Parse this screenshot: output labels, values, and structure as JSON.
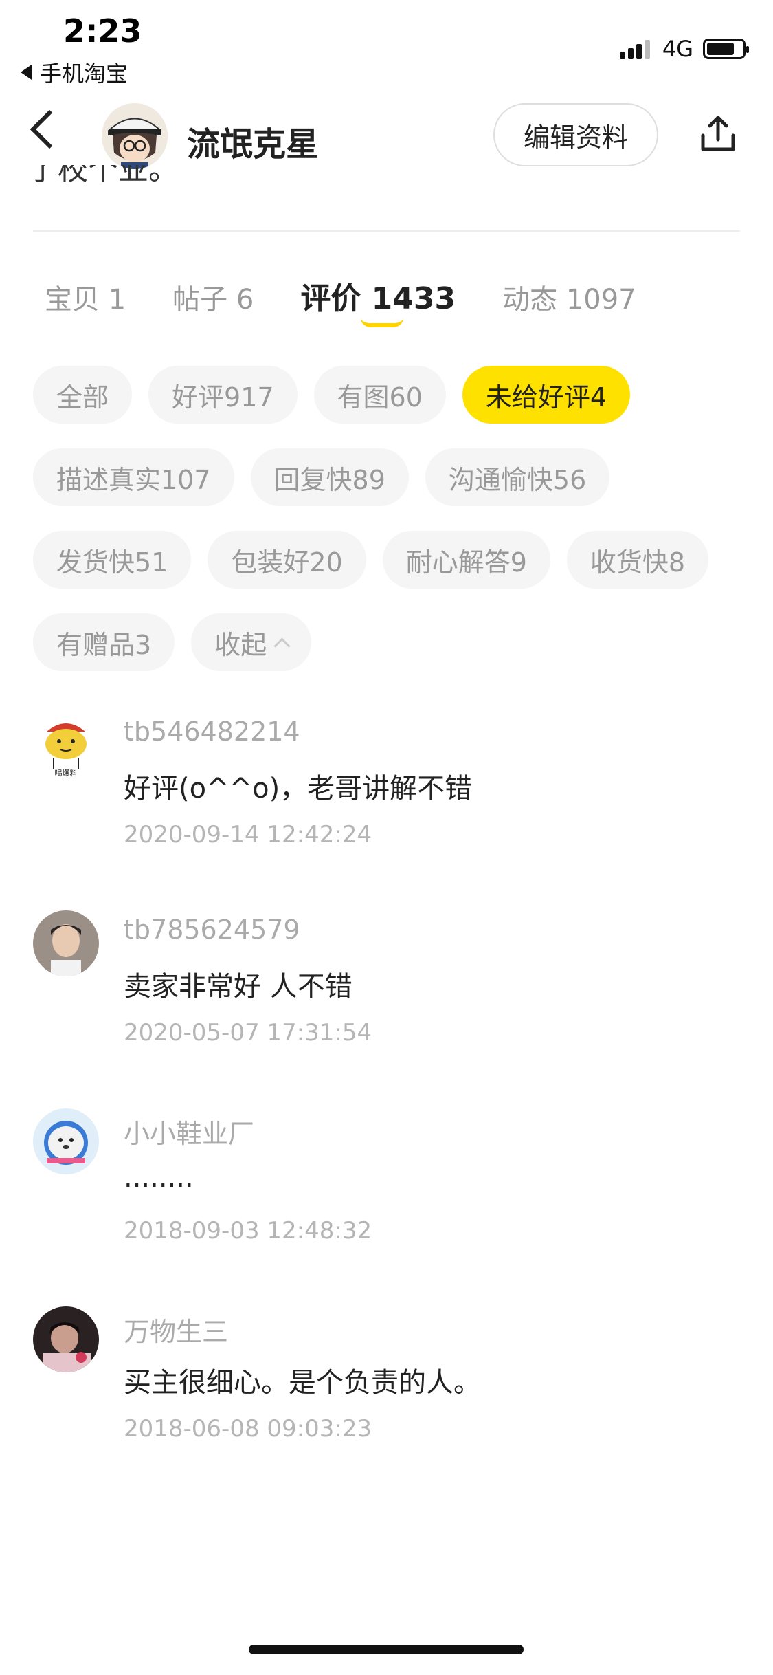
{
  "status_bar": {
    "time": "2:23",
    "back_app": "手机淘宝",
    "network": "4G"
  },
  "header": {
    "username": "流氓克星",
    "edit_button": "编辑资料",
    "peek_text": "了校个业。"
  },
  "tabs": [
    {
      "label": "宝贝 1"
    },
    {
      "label": "帖子 6"
    },
    {
      "label": "评价 1433",
      "active": true
    },
    {
      "label": "动态 1097"
    }
  ],
  "filters": [
    {
      "label": "全部"
    },
    {
      "label": "好评917"
    },
    {
      "label": "有图60"
    },
    {
      "label": "未给好评4",
      "active": true
    },
    {
      "label": "描述真实107"
    },
    {
      "label": "回复快89"
    },
    {
      "label": "沟通愉快56"
    },
    {
      "label": "发货快51"
    },
    {
      "label": "包装好20"
    },
    {
      "label": "耐心解答9"
    },
    {
      "label": "收货快8"
    },
    {
      "label": "有赠品3"
    },
    {
      "label": "收起"
    }
  ],
  "reviews": [
    {
      "user": "tb546482214",
      "text": "好评(o^^o)，老哥讲解不错",
      "date": "2020-09-14 12:42:24"
    },
    {
      "user": "tb785624579",
      "text": "卖家非常好 人不错",
      "date": "2020-05-07 17:31:54"
    },
    {
      "user": "小小鞋业厂",
      "text": "........",
      "date": "2018-09-03 12:48:32"
    },
    {
      "user": "万物生三",
      "text": "买主很细心。是个负责的人。",
      "date": "2018-06-08 09:03:23"
    }
  ],
  "colors": {
    "accent": "#ffe100",
    "underline": "#ffd400",
    "muted_text": "#999999",
    "chip_bg": "#f5f5f5"
  }
}
